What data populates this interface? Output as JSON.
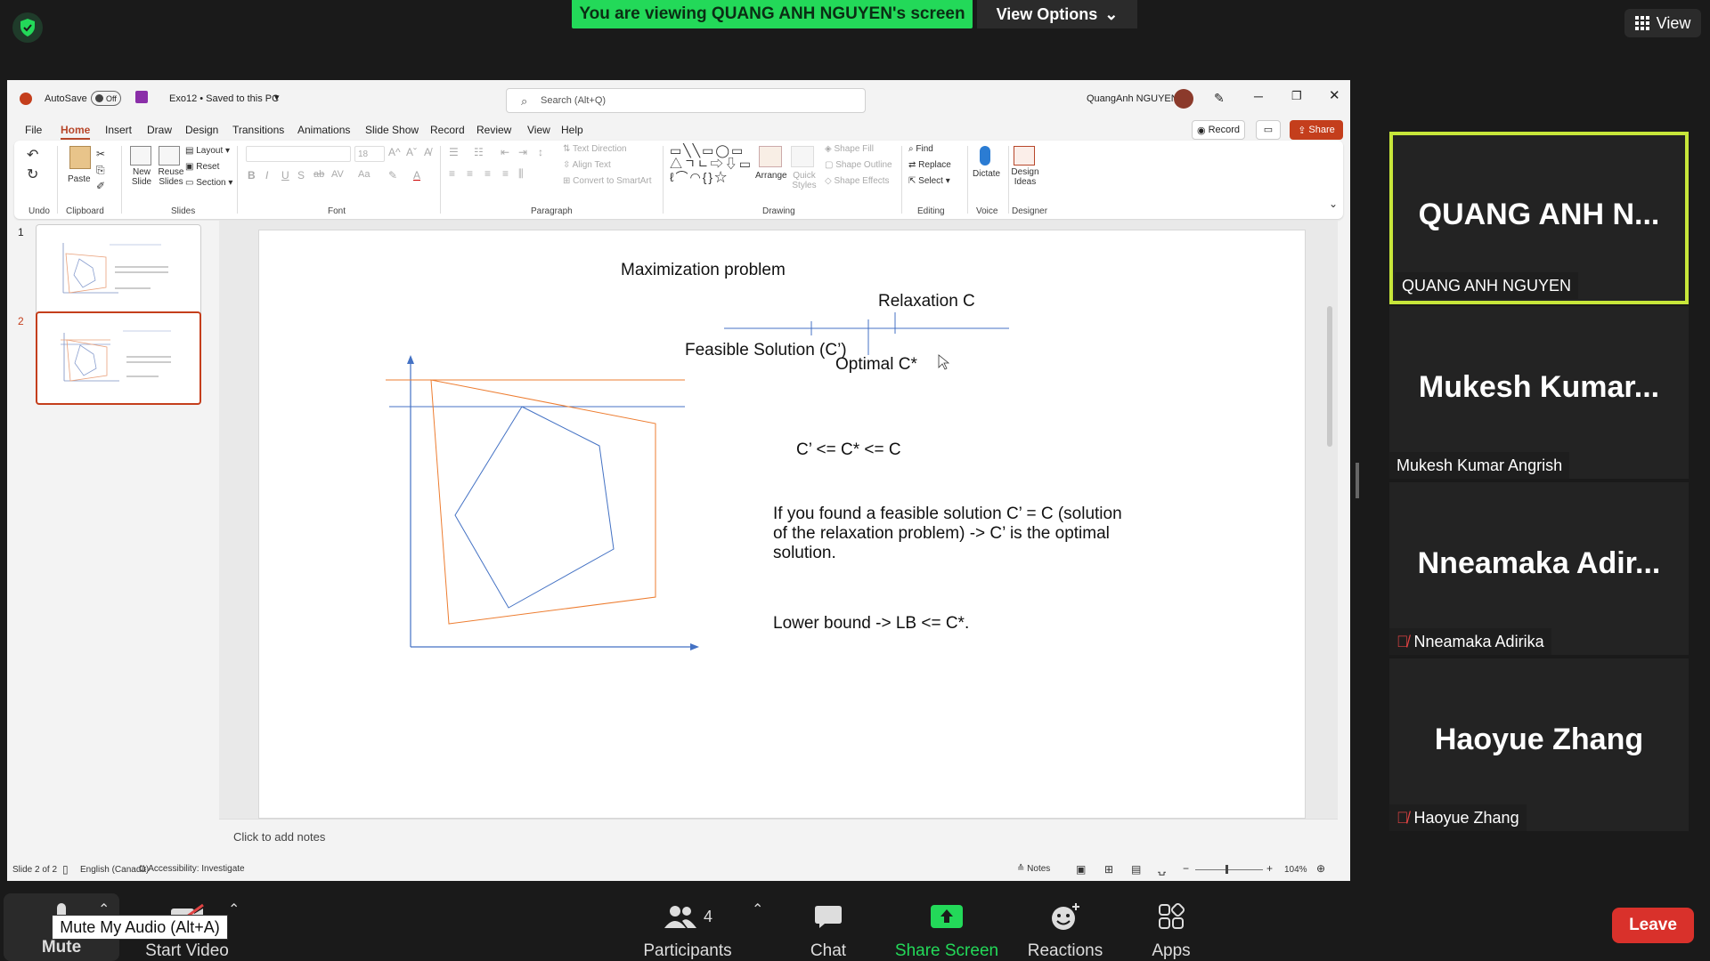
{
  "zoom": {
    "banner": "You are viewing QUANG ANH NGUYEN's screen",
    "view_options": "View Options",
    "top_view": "View",
    "colors": {
      "banner": "#23d959",
      "active_speaker": "#c7e63a",
      "leave": "#d9312b"
    }
  },
  "ppt": {
    "autosave_label": "AutoSave",
    "autosave_state": "Off",
    "doc_title": "Exo12 • Saved to this PC",
    "search_placeholder": "Search (Alt+Q)",
    "user": "QuangAnh NGUYEN",
    "tabs": [
      "File",
      "Home",
      "Insert",
      "Draw",
      "Design",
      "Transitions",
      "Animations",
      "Slide Show",
      "Record",
      "Review",
      "View",
      "Help"
    ],
    "record": "Record",
    "share": "Share",
    "ribbon": {
      "undo_group": "Undo",
      "paste": "Paste",
      "clipboard_group": "Clipboard",
      "new_slide": "New Slide",
      "reuse_slides": "Reuse Slides",
      "layout": "Layout",
      "reset": "Reset",
      "section": "Section",
      "slides_group": "Slides",
      "font_size": "18",
      "font_group": "Font",
      "text_direction": "Text Direction",
      "align_text": "Align Text",
      "convert_smartart": "Convert to SmartArt",
      "paragraph_group": "Paragraph",
      "arrange": "Arrange",
      "quick_styles": "Quick Styles",
      "shape_fill": "Shape Fill",
      "shape_outline": "Shape Outline",
      "shape_effects": "Shape Effects",
      "drawing_group": "Drawing",
      "find": "Find",
      "replace": "Replace",
      "select": "Select",
      "editing_group": "Editing",
      "dictate": "Dictate",
      "voice_group": "Voice",
      "design_ideas": "Design Ideas",
      "designer_group": "Designer"
    },
    "thumb_numbers": [
      "1",
      "2"
    ],
    "slide": {
      "title": "Maximization problem",
      "relaxation": "Relaxation C",
      "feasible": "Feasible Solution (C’)",
      "optimal": "Optimal C*",
      "inequality": "C’ <= C* <= C",
      "para_line1": "If you found a feasible solution C’ = C (solution",
      "para_line2": "of the relaxation problem) -> C’ is the optimal",
      "para_line3": "solution.",
      "lower_bound": "Lower bound -> LB <= C*."
    },
    "notes_placeholder": "Click to add notes",
    "status": {
      "slide_count": "Slide 2 of 2",
      "language": "English (Canada)",
      "accessibility": "Accessibility: Investigate",
      "notes": "Notes",
      "zoom": "104%"
    }
  },
  "participants": [
    {
      "display": "QUANG ANH N...",
      "label": "QUANG ANH NGUYEN",
      "muted": false
    },
    {
      "display": "Mukesh Kumar...",
      "label": "Mukesh Kumar Angrish",
      "muted": false
    },
    {
      "display": "Nneamaka Adir...",
      "label": "Nneamaka Adirika",
      "muted": true
    },
    {
      "display": "Haoyue Zhang",
      "label": "Haoyue Zhang",
      "muted": true
    }
  ],
  "toolbar": {
    "mute": "Mute",
    "start_video": "Start Video",
    "participants": "Participants",
    "participants_count": "4",
    "chat": "Chat",
    "share_screen": "Share Screen",
    "reactions": "Reactions",
    "apps": "Apps",
    "leave": "Leave",
    "tooltip": "Mute My Audio (Alt+A)"
  }
}
